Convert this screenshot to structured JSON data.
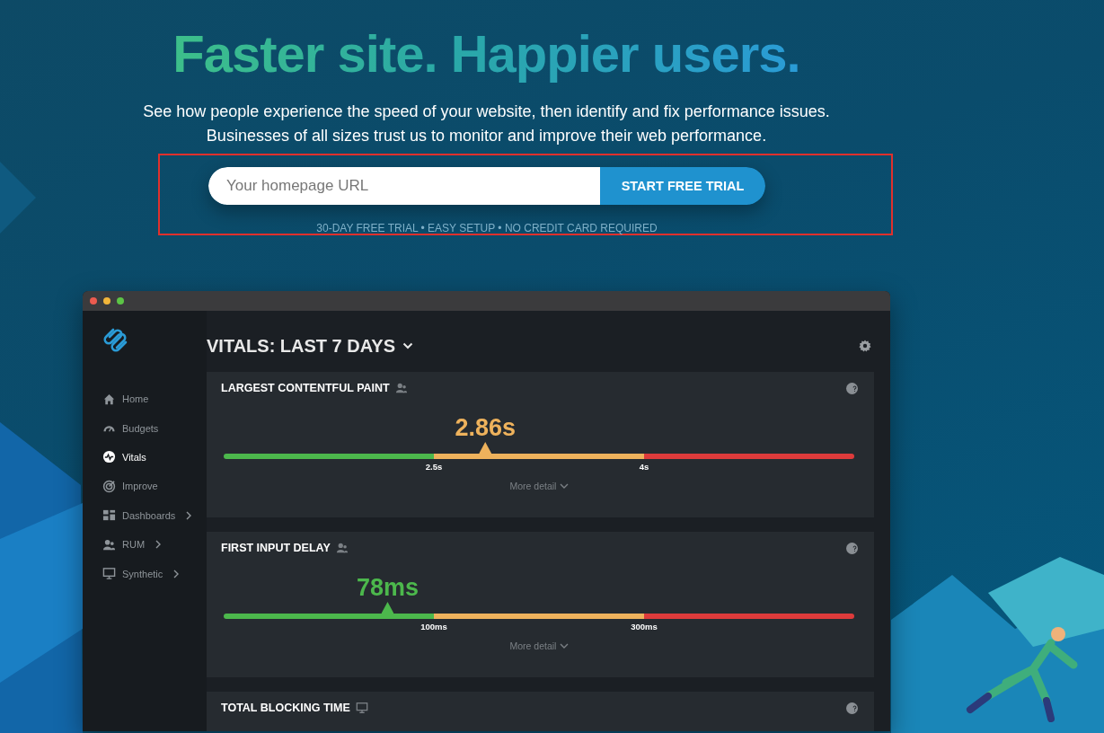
{
  "hero": {
    "headline": "Faster site. Happier users.",
    "subtitle_lines": [
      "See how people experience the speed of your website, then identify and fix performance issues.",
      "Businesses of all sizes trust us to monitor and improve their web performance."
    ],
    "url_field": {
      "placeholder": "Your homepage URL"
    },
    "cta_button": "START FREE TRIAL",
    "fine_print": "30-DAY FREE TRIAL • EASY SETUP • NO CREDIT CARD REQUIRED"
  },
  "dashboard": {
    "title": "VITALS: LAST 7 DAYS",
    "sidebar": {
      "items": [
        {
          "label": "Home",
          "selected": false,
          "has_submenu": false
        },
        {
          "label": "Budgets",
          "selected": false,
          "has_submenu": false
        },
        {
          "label": "Vitals",
          "selected": true,
          "has_submenu": false
        },
        {
          "label": "Improve",
          "selected": false,
          "has_submenu": false
        },
        {
          "label": "Dashboards",
          "selected": false,
          "has_submenu": true
        },
        {
          "label": "RUM",
          "selected": false,
          "has_submenu": true
        },
        {
          "label": "Synthetic",
          "selected": false,
          "has_submenu": true
        }
      ]
    },
    "cards": [
      {
        "title": "LARGEST CONTENTFUL PAINT",
        "value": "2.86s",
        "color": "#eeb25c",
        "level": 0.415,
        "thresholds": [
          "2.5s",
          "4s"
        ],
        "more": "More detail"
      },
      {
        "title": "FIRST INPUT DELAY",
        "value": "78ms",
        "color": "#4cb84c",
        "level": 0.26,
        "thresholds": [
          "100ms",
          "300ms"
        ],
        "more": "More detail"
      },
      {
        "title": "TOTAL BLOCKING TIME"
      }
    ]
  }
}
